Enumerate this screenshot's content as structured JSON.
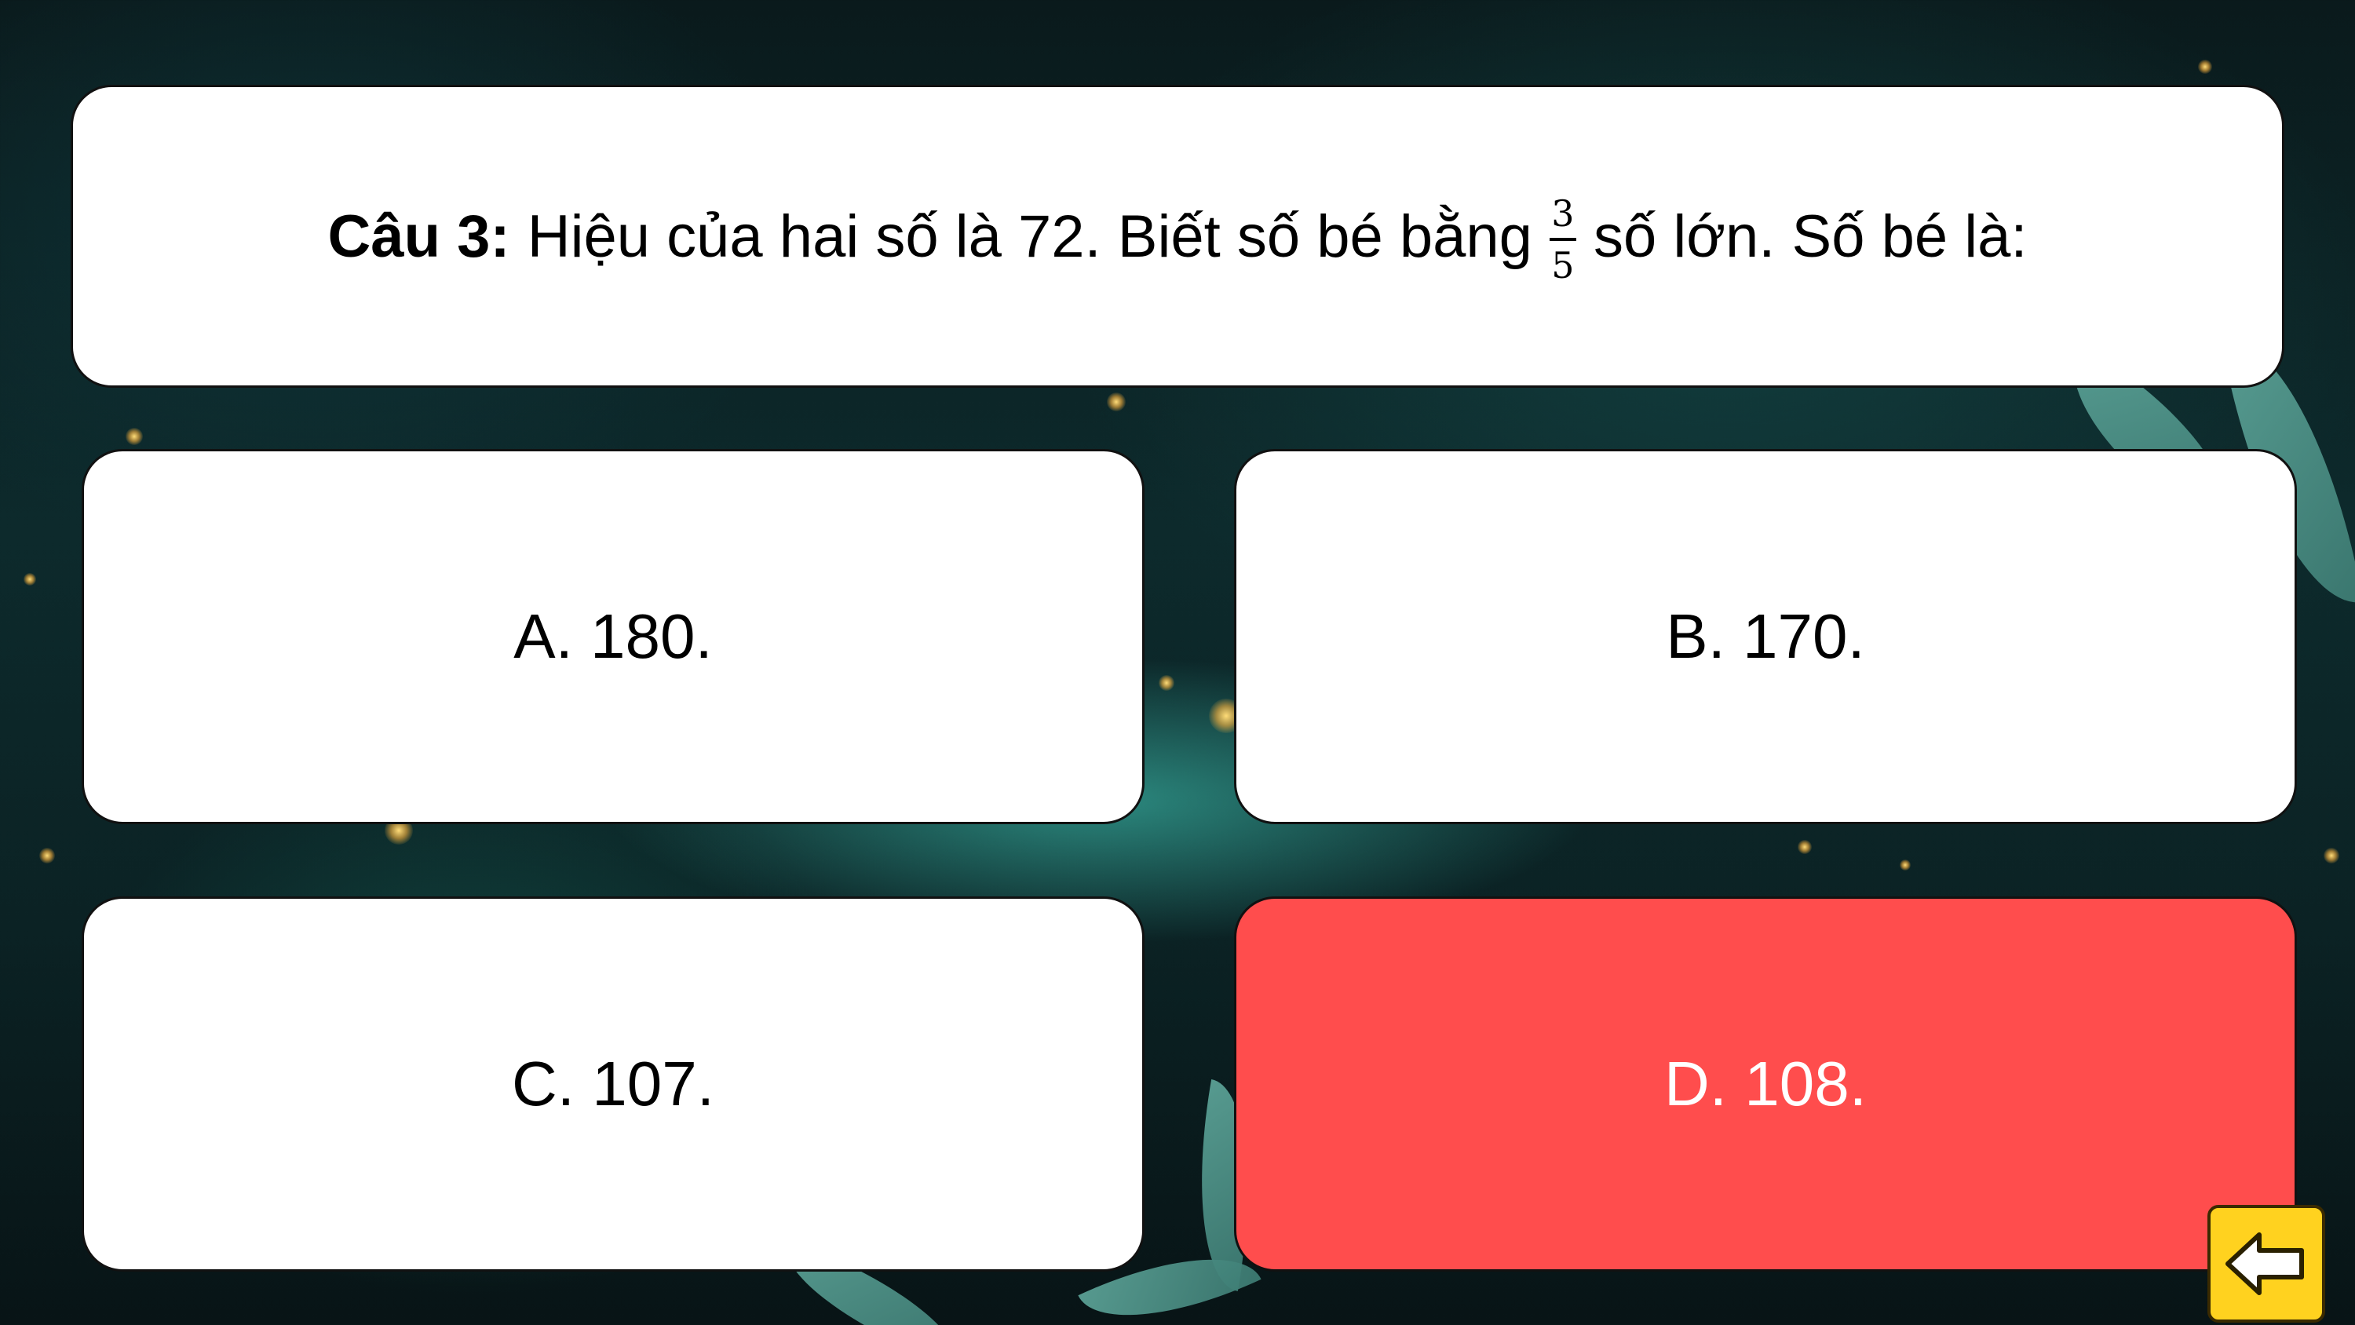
{
  "question": {
    "label": "Câu 3:",
    "text_before": "Hiệu của hai số là 72. Biết số bé bằng",
    "fraction_numerator": "3",
    "fraction_denominator": "5",
    "text_after": "số lớn. Số bé là:"
  },
  "answers": [
    {
      "label": "A. 180."
    },
    {
      "label": "B. 170."
    },
    {
      "label": "C. 107."
    },
    {
      "label": "D. 108."
    }
  ],
  "colors": {
    "card": "#ffffff",
    "selected_answer": "#ff4d4d",
    "back_button": "#ffd21f"
  },
  "icons": {
    "back": "arrow-left-icon"
  }
}
